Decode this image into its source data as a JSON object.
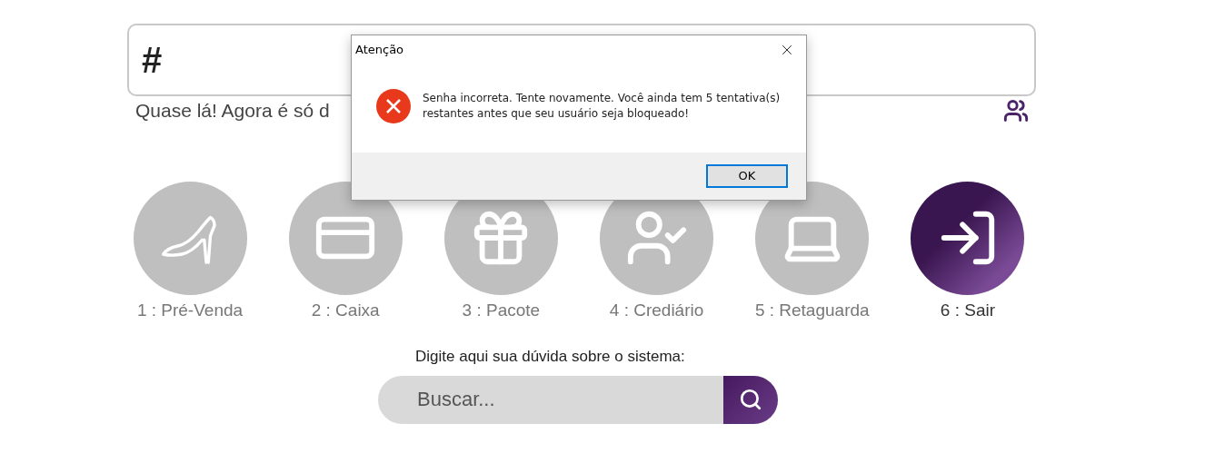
{
  "code_field": {
    "value": "#"
  },
  "hint": "Quase lá! Agora é só d",
  "modules": [
    {
      "label": "1 : Pré-Venda",
      "kind": "shoe",
      "selected": false
    },
    {
      "label": "2 : Caixa",
      "kind": "card",
      "selected": false
    },
    {
      "label": "3 : Pacote",
      "kind": "gift",
      "selected": false
    },
    {
      "label": "4 : Crediário",
      "kind": "usercheck",
      "selected": false
    },
    {
      "label": "5 : Retaguarda",
      "kind": "laptop",
      "selected": false
    },
    {
      "label": "6 : Sair",
      "kind": "exit",
      "selected": true
    }
  ],
  "help": {
    "label": "Digite aqui sua dúvida sobre o sistema:",
    "placeholder": "Buscar..."
  },
  "dialog": {
    "title": "Atenção",
    "message": "Senha incorreta. Tente novamente. Você ainda tem 5 tentativa(s) restantes antes que seu usuário seja bloqueado!",
    "button": "OK"
  }
}
